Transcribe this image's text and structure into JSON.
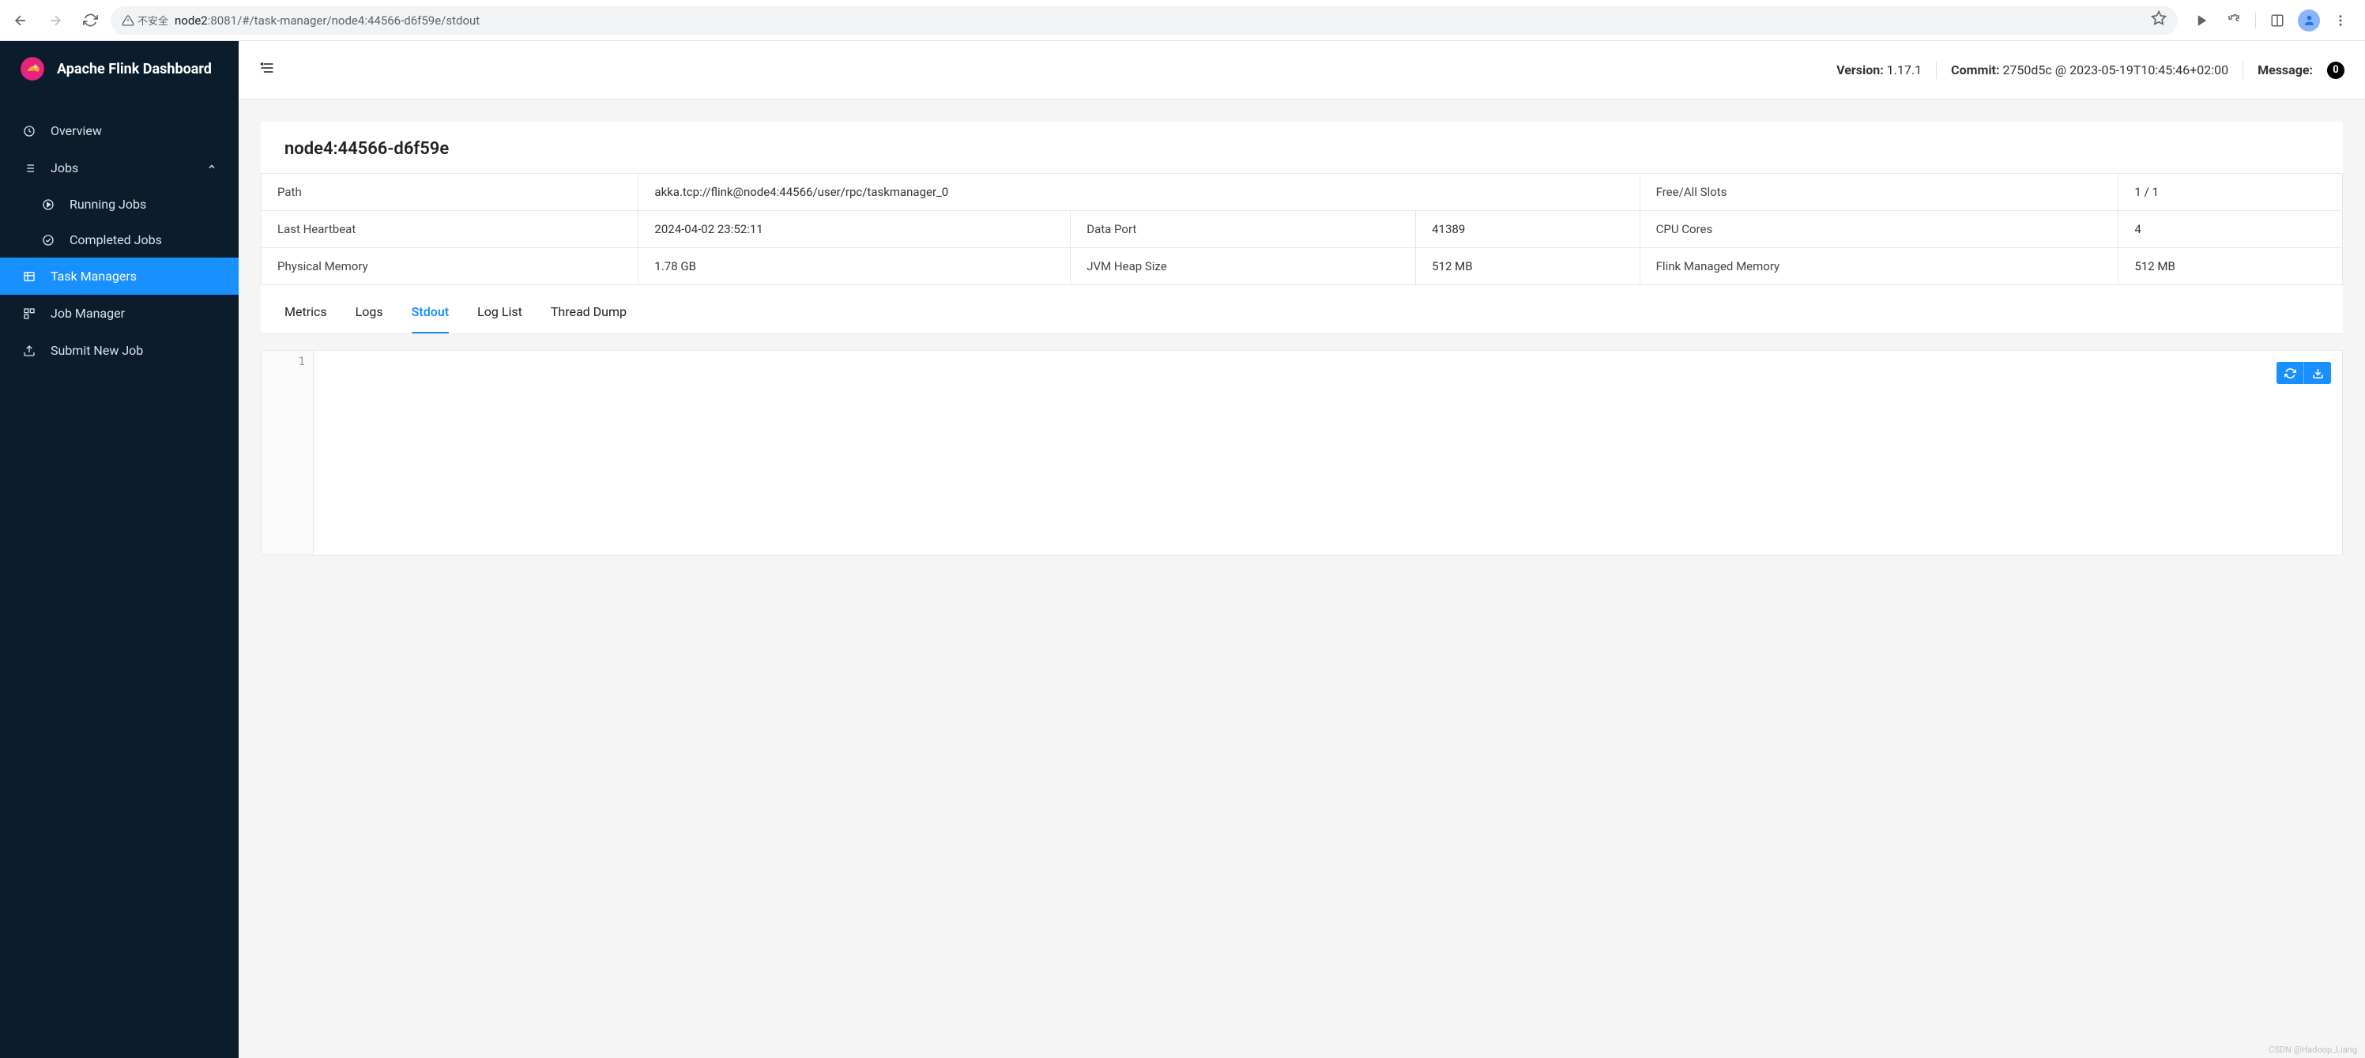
{
  "browser": {
    "insecure_label": "不安全",
    "url_host": "node2",
    "url_port": ":8081",
    "url_path": "/#/task-manager/node4:44566-d6f59e/stdout"
  },
  "brand": {
    "title": "Apache Flink Dashboard"
  },
  "sidebar": {
    "overview": "Overview",
    "jobs": "Jobs",
    "running_jobs": "Running Jobs",
    "completed_jobs": "Completed Jobs",
    "task_managers": "Task Managers",
    "job_manager": "Job Manager",
    "submit_new_job": "Submit New Job"
  },
  "topbar": {
    "version_label": "Version:",
    "version_value": "1.17.1",
    "commit_label": "Commit:",
    "commit_value": "2750d5c @ 2023-05-19T10:45:46+02:00",
    "message_label": "Message:",
    "message_count": "0"
  },
  "page_title": "node4:44566-d6f59e",
  "info": {
    "path_k": "Path",
    "path_v": "akka.tcp://flink@node4:44566/user/rpc/taskmanager_0",
    "slots_k": "Free/All Slots",
    "slots_v": "1 / 1",
    "heartbeat_k": "Last Heartbeat",
    "heartbeat_v": "2024-04-02 23:52:11",
    "dataport_k": "Data Port",
    "dataport_v": "41389",
    "cpucores_k": "CPU Cores",
    "cpucores_v": "4",
    "physmem_k": "Physical Memory",
    "physmem_v": "1.78 GB",
    "jvmheap_k": "JVM Heap Size",
    "jvmheap_v": "512 MB",
    "flinkmem_k": "Flink Managed Memory",
    "flinkmem_v": "512 MB"
  },
  "tabs": {
    "metrics": "Metrics",
    "logs": "Logs",
    "stdout": "Stdout",
    "loglist": "Log List",
    "threaddump": "Thread Dump"
  },
  "log": {
    "line1_num": "1",
    "line1_text": ""
  },
  "watermark": "CSDN @Hadoop_Liang"
}
